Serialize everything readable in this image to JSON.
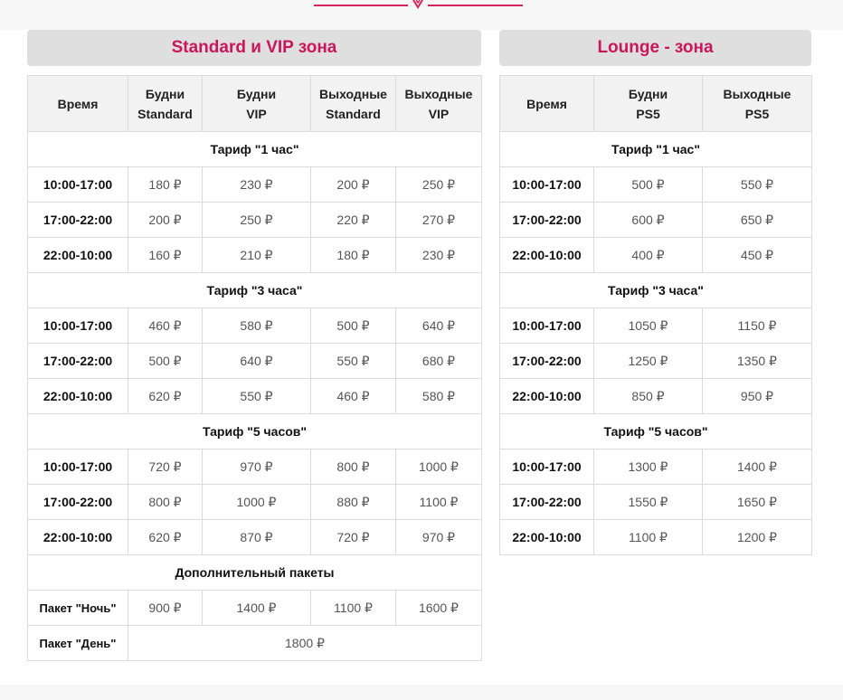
{
  "standard": {
    "title": "Standard и VIP зона",
    "headers": [
      [
        "Время"
      ],
      [
        "Будни",
        "Standard"
      ],
      [
        "Будни",
        "VIP"
      ],
      [
        "Выходные",
        "Standard"
      ],
      [
        "Выходные",
        "VIP"
      ]
    ],
    "groups": [
      {
        "title": "Тариф \"1 час\"",
        "rows": [
          {
            "time": "10:00-17:00",
            "cells": [
              "180 ₽",
              "230 ₽",
              "200 ₽",
              "250 ₽"
            ]
          },
          {
            "time": "17:00-22:00",
            "cells": [
              "200 ₽",
              "250 ₽",
              "220 ₽",
              "270 ₽"
            ]
          },
          {
            "time": "22:00-10:00",
            "cells": [
              "160 ₽",
              "210 ₽",
              "180 ₽",
              "230 ₽"
            ]
          }
        ]
      },
      {
        "title": "Тариф \"3 часа\"",
        "rows": [
          {
            "time": "10:00-17:00",
            "cells": [
              "460 ₽",
              "580 ₽",
              "500 ₽",
              "640 ₽"
            ]
          },
          {
            "time": "17:00-22:00",
            "cells": [
              "500 ₽",
              "640 ₽",
              "550 ₽",
              "680 ₽"
            ]
          },
          {
            "time": "22:00-10:00",
            "cells": [
              "620 ₽",
              "550 ₽",
              "460 ₽",
              "580 ₽"
            ]
          }
        ]
      },
      {
        "title": "Тариф \"5 часов\"",
        "rows": [
          {
            "time": "10:00-17:00",
            "cells": [
              "720 ₽",
              "970 ₽",
              "800 ₽",
              "1000 ₽"
            ]
          },
          {
            "time": "17:00-22:00",
            "cells": [
              "800 ₽",
              "1000 ₽",
              "880 ₽",
              "1100 ₽"
            ]
          },
          {
            "time": "22:00-10:00",
            "cells": [
              "620 ₽",
              "870 ₽",
              "720 ₽",
              "970 ₽"
            ]
          }
        ]
      }
    ],
    "packages": {
      "title": "Дополнительный пакеты",
      "rows": [
        {
          "time": "Пакет \"Ночь\"",
          "cells": [
            "900 ₽",
            "1400 ₽",
            "1100 ₽",
            "1600 ₽"
          ]
        },
        {
          "time": "Пакет \"День\"",
          "cells": [
            "1800 ₽"
          ]
        }
      ]
    }
  },
  "lounge": {
    "title": "Lounge - зона",
    "headers": [
      [
        "Время"
      ],
      [
        "Будни",
        "PS5"
      ],
      [
        "Выходные",
        "PS5"
      ]
    ],
    "groups": [
      {
        "title": "Тариф \"1 час\"",
        "rows": [
          {
            "time": "10:00-17:00",
            "cells": [
              "500 ₽",
              "550 ₽"
            ]
          },
          {
            "time": "17:00-22:00",
            "cells": [
              "600 ₽",
              "650 ₽"
            ]
          },
          {
            "time": "22:00-10:00",
            "cells": [
              "400 ₽",
              "450 ₽"
            ]
          }
        ]
      },
      {
        "title": "Тариф \"3 часа\"",
        "rows": [
          {
            "time": "10:00-17:00",
            "cells": [
              "1050 ₽",
              "1150 ₽"
            ]
          },
          {
            "time": "17:00-22:00",
            "cells": [
              "1250 ₽",
              "1350 ₽"
            ]
          },
          {
            "time": "22:00-10:00",
            "cells": [
              "850 ₽",
              "950 ₽"
            ]
          }
        ]
      },
      {
        "title": "Тариф \"5 часов\"",
        "rows": [
          {
            "time": "10:00-17:00",
            "cells": [
              "1300 ₽",
              "1400 ₽"
            ]
          },
          {
            "time": "17:00-22:00",
            "cells": [
              "1550 ₽",
              "1650 ₽"
            ]
          },
          {
            "time": "22:00-10:00",
            "cells": [
              "1100 ₽",
              "1200 ₽"
            ]
          }
        ]
      }
    ]
  },
  "colors": {
    "accent": "#c8175a",
    "title_bg": "#dfdfdf",
    "header_bg": "#f2f2f2",
    "border": "#dcdcdc"
  },
  "icons": {
    "divider": "chevron-down-icon"
  }
}
